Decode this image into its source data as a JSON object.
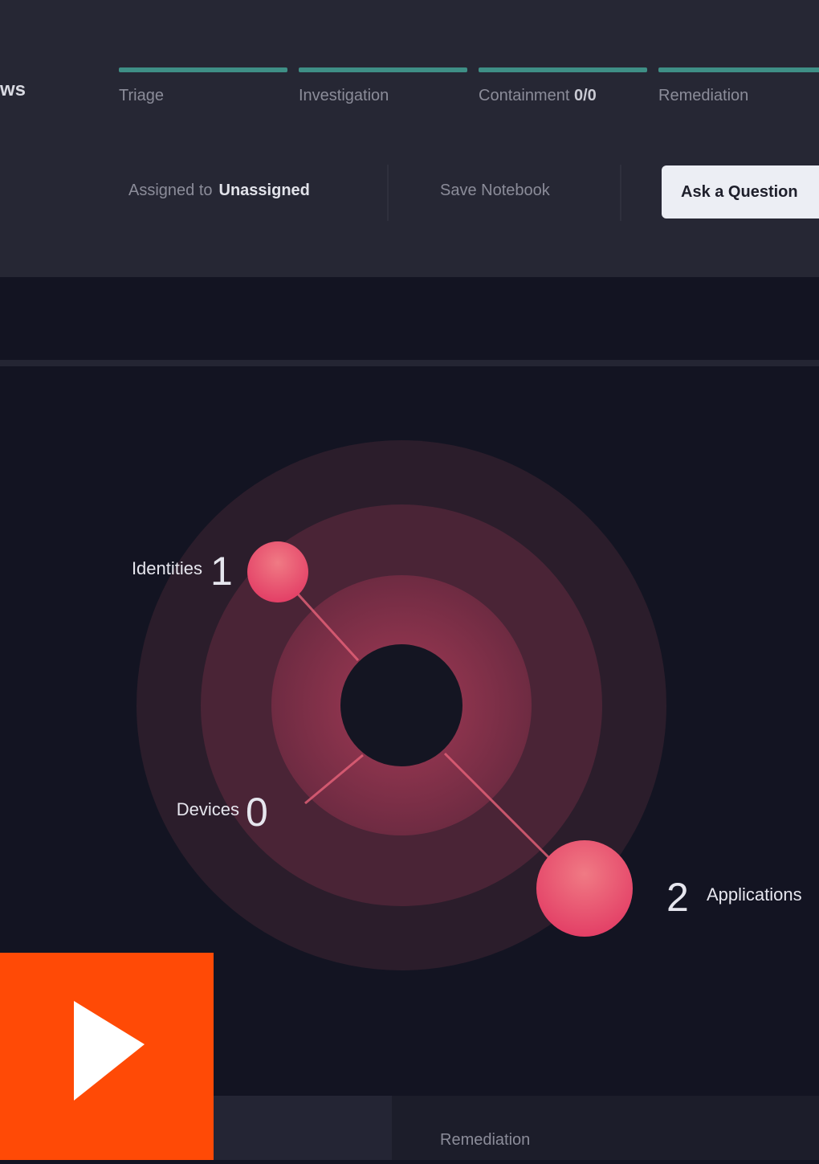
{
  "header": {
    "title_fragment": "ws",
    "stages": [
      {
        "label": "Triage",
        "count": ""
      },
      {
        "label": "Investigation",
        "count": ""
      },
      {
        "label": "Containment",
        "count": "0/0"
      },
      {
        "label": "Remediation",
        "count": ""
      }
    ],
    "assigned_label": "Assigned to",
    "assigned_value": "Unassigned",
    "save_label": "Save Notebook",
    "ask_label": "Ask a Question"
  },
  "graph": {
    "nodes": [
      {
        "label": "Identities",
        "count": "1"
      },
      {
        "label": "Devices",
        "count": "0"
      },
      {
        "label": "Applications",
        "count": "2"
      }
    ]
  },
  "bottom": {
    "tab_label": "Remediation"
  },
  "colors": {
    "accent_teal": "#3f8f86",
    "node_pink": "#e84a6c",
    "play_orange": "#ff4a06"
  },
  "icons": {
    "play": "play-icon"
  }
}
